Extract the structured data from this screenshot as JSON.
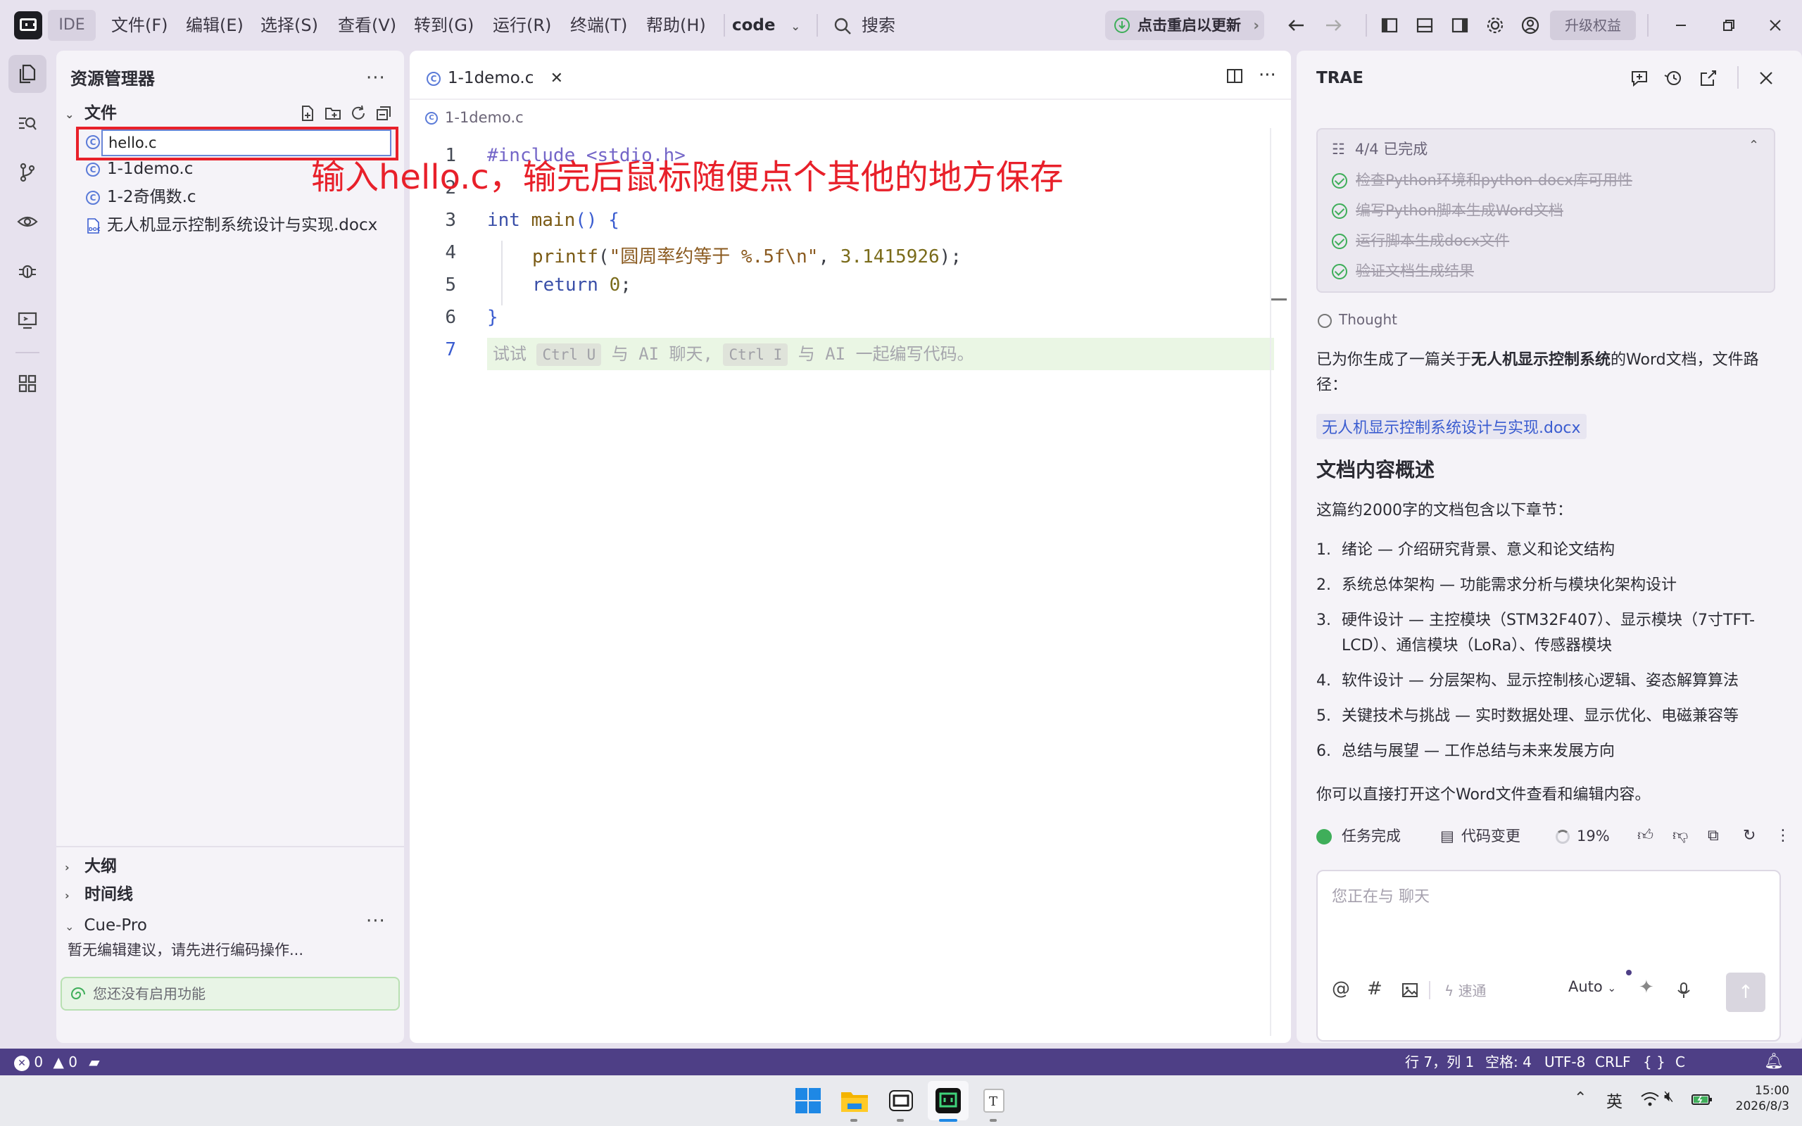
{
  "titlebar": {
    "ide_label": "IDE",
    "menus": [
      "文件(F)",
      "编辑(E)",
      "选择(S)",
      "查看(V)",
      "转到(G)",
      "运行(R)",
      "终端(T)",
      "帮助(H)"
    ],
    "workspace": "code",
    "search": "搜索",
    "update": "点击重启以更新",
    "upgrade": "升级权益"
  },
  "explorer": {
    "title": "资源管理器",
    "more": "···",
    "section_files": "文件",
    "rename_value": "hello.c",
    "files": [
      "1-1demo.c",
      "1-2奇偶数.c",
      "无人机显示控制系统设计与实现.docx"
    ],
    "section_outline": "大纲",
    "section_timeline": "时间线",
    "section_cue": "Cue-Pro",
    "cue_message": "暂无编辑建议，请先进行编码操作...",
    "cue_banner": "您还没有启用功能"
  },
  "editor": {
    "tab": "1-1demo.c",
    "breadcrumb": "1-1demo.c",
    "line_numbers": [
      "1",
      "2",
      "3",
      "4",
      "5",
      "6",
      "7"
    ],
    "code": {
      "l1": "#include <stdio.h>",
      "l3_kw": "int",
      "l3_fn": "main",
      "l3_rest": "() {",
      "l4_fn": "printf",
      "l4_open": "(",
      "l4_str": "\"圆周率约等于 %.5f\\n\"",
      "l4_comma": ", ",
      "l4_num": "3.1415926",
      "l4_close": ");",
      "l5_kw": "return",
      "l5_num": "0",
      "l5_end": ";",
      "l6": "}"
    },
    "hint": {
      "p1": "试试",
      "k1": "Ctrl U",
      "p2": "与 AI 聊天,",
      "k2": "Ctrl I",
      "p3": "与 AI 一起编写代码。"
    },
    "annotation": "输入hello.c，输完后鼠标随便点个其他的地方保存"
  },
  "chat": {
    "title": "TRAE",
    "todo_head": "4/4 已完成",
    "todos": [
      "检查Python环境和python-docx库可用性",
      "编写Python脚本生成Word文档",
      "运行脚本生成docx文件",
      "验证文档生成结果"
    ],
    "thought": "Thought",
    "intro_pre": "已为你生成了一篇关于",
    "intro_bold": "无人机显示控制系统",
    "intro_post": "的Word文档，文件路径：",
    "file_link": "无人机显示控制系统设计与实现.docx",
    "heading": "文档内容概述",
    "summary": "这篇约2000字的文档包含以下章节：",
    "sections": [
      {
        "n": "1.",
        "t": "绪论 — 介绍研究背景、意义和论文结构"
      },
      {
        "n": "2.",
        "t": "系统总体架构 — 功能需求分析与模块化架构设计"
      },
      {
        "n": "3.",
        "t": "硬件设计 — 主控模块（STM32F407）、显示模块（7寸TFT-LCD）、通信模块（LoRa）、传感器模块"
      },
      {
        "n": "4.",
        "t": "软件设计 — 分层架构、显示控制核心逻辑、姿态解算算法"
      },
      {
        "n": "5.",
        "t": "关键技术与挑战 — 实时数据处理、显示优化、电磁兼容等"
      },
      {
        "n": "6.",
        "t": "总结与展望 — 工作总结与未来发展方向"
      }
    ],
    "outro": "你可以直接打开这个Word文件查看和编辑内容。",
    "task_done": "任务完成",
    "code_change": "代码变更",
    "progress": "19%",
    "input_placeholder": "您正在与 聊天",
    "speed": "速通",
    "model": "Auto"
  },
  "statusbar": {
    "errors": "0",
    "warnings": "0",
    "position": "行 7，列 1",
    "spaces": "空格: 4",
    "encoding": "UTF-8",
    "eol": "CRLF",
    "braces": "{ }",
    "lang": "C"
  },
  "taskbar": {
    "ime": "英",
    "time": "15:00",
    "date": "2026/8/3"
  },
  "colors": {
    "accent": "#4e3f86",
    "annotation": "#e8202a",
    "success": "#3fae5a",
    "link": "#3a5cd0"
  }
}
